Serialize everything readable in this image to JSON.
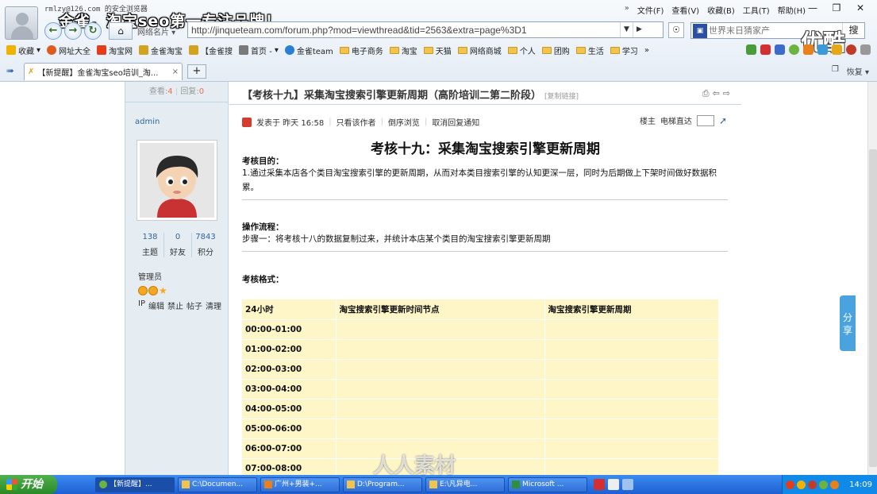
{
  "chrome": {
    "account": "rmlzy@126.com 的安全浏览器",
    "slogan": "金雀，淘宝seo第一专注品牌！",
    "menu": [
      "»",
      "文件(F)",
      "查看(V)",
      "收藏(B)",
      "工具(T)",
      "帮助(H)"
    ],
    "window_controls": [
      "—",
      "❐",
      "✕"
    ],
    "favsite_label": "网络名片 ▾",
    "address": "http://jinqueteam.com/forum.php?mod=viewthread&tid=2563&extra=page%3D1",
    "search_placeholder": "世界末日猜家产",
    "search_button": "搜",
    "overlay_logo": "优酷",
    "favorites": [
      {
        "label": "收藏",
        "color": "#f2b200"
      },
      {
        "label": "网址大全",
        "color": "#e05a1b"
      },
      {
        "label": "淘宝网",
        "color": "#e33d1a"
      },
      {
        "label": "金雀淘宝",
        "color": "#d3a21e"
      },
      {
        "label": "【金雀搜",
        "color": "#d3a21e"
      },
      {
        "label": "首页 -",
        "color": "#7a7a7a"
      },
      {
        "label": "金雀team",
        "color": "#2a7fd4"
      }
    ],
    "folders": [
      "电子商务",
      "淘宝",
      "天猫",
      "网络商城",
      "个人",
      "团购",
      "生活",
      "学习"
    ],
    "favbar_more": "»",
    "tab_title": "【新提醒】金雀淘宝seo培训_淘...",
    "tab_close": "×",
    "new_tab": "+",
    "tab_right": [
      "❐",
      "恢复 ▾"
    ]
  },
  "post": {
    "views_label": "查看:",
    "views": "4",
    "replies_label": "回复:",
    "replies": "0",
    "author": "admin",
    "author_stats": [
      {
        "value": "138",
        "label": "主题"
      },
      {
        "value": "0",
        "label": "好友"
      },
      {
        "value": "7843",
        "label": "积分"
      }
    ],
    "author_group": "管理员",
    "author_actions": [
      "IP",
      "编辑",
      "禁止",
      "帖子",
      "清理"
    ],
    "title": "【考核十九】采集淘宝搜索引擎更新周期（高阶培训二第二阶段）",
    "copy_link": "[复制链接]",
    "meta": {
      "posted": "发表于 昨天 16:58",
      "only_author": "只看该作者",
      "reverse": "倒序浏览",
      "cancel_notify": "取消回复通知"
    },
    "floor_owner": "楼主",
    "floor_jump": "电梯直达"
  },
  "doc": {
    "title": "考核十九：采集淘宝搜索引擎更新周期",
    "goal_heading": "考核目的：",
    "goal_text": "1.通过采集本店各个类目淘宝搜索引擎的更新周期，从而对本类目搜索引擎的认知更深一层，同时为后期做上下架时间做好数据积累。",
    "process_heading": "操作流程：",
    "process_text": "步骤一：将考核十八的数据复制过来，并统计本店某个类目的淘宝搜索引擎更新周期",
    "format_heading": "考核格式：",
    "table_headers": [
      "24小时",
      "淘宝搜索引擎更新时间节点",
      "淘宝搜索引擎更新周期"
    ],
    "time_slots": [
      "00:00-01:00",
      "01:00-02:00",
      "02:00-03:00",
      "03:00-04:00",
      "04:00-05:00",
      "05:00-06:00",
      "06:00-07:00",
      "07:00-08:00"
    ]
  },
  "share_tab": "分享",
  "taskbar": {
    "start": "开始",
    "tasks": [
      "【新提醒】...",
      "C:\\Documen...",
      "广州+男装+...",
      "D:\\Program...",
      "E:\\凡异电...",
      "Microsoft ..."
    ],
    "clock": "14:09"
  },
  "watermark": "人人素材"
}
